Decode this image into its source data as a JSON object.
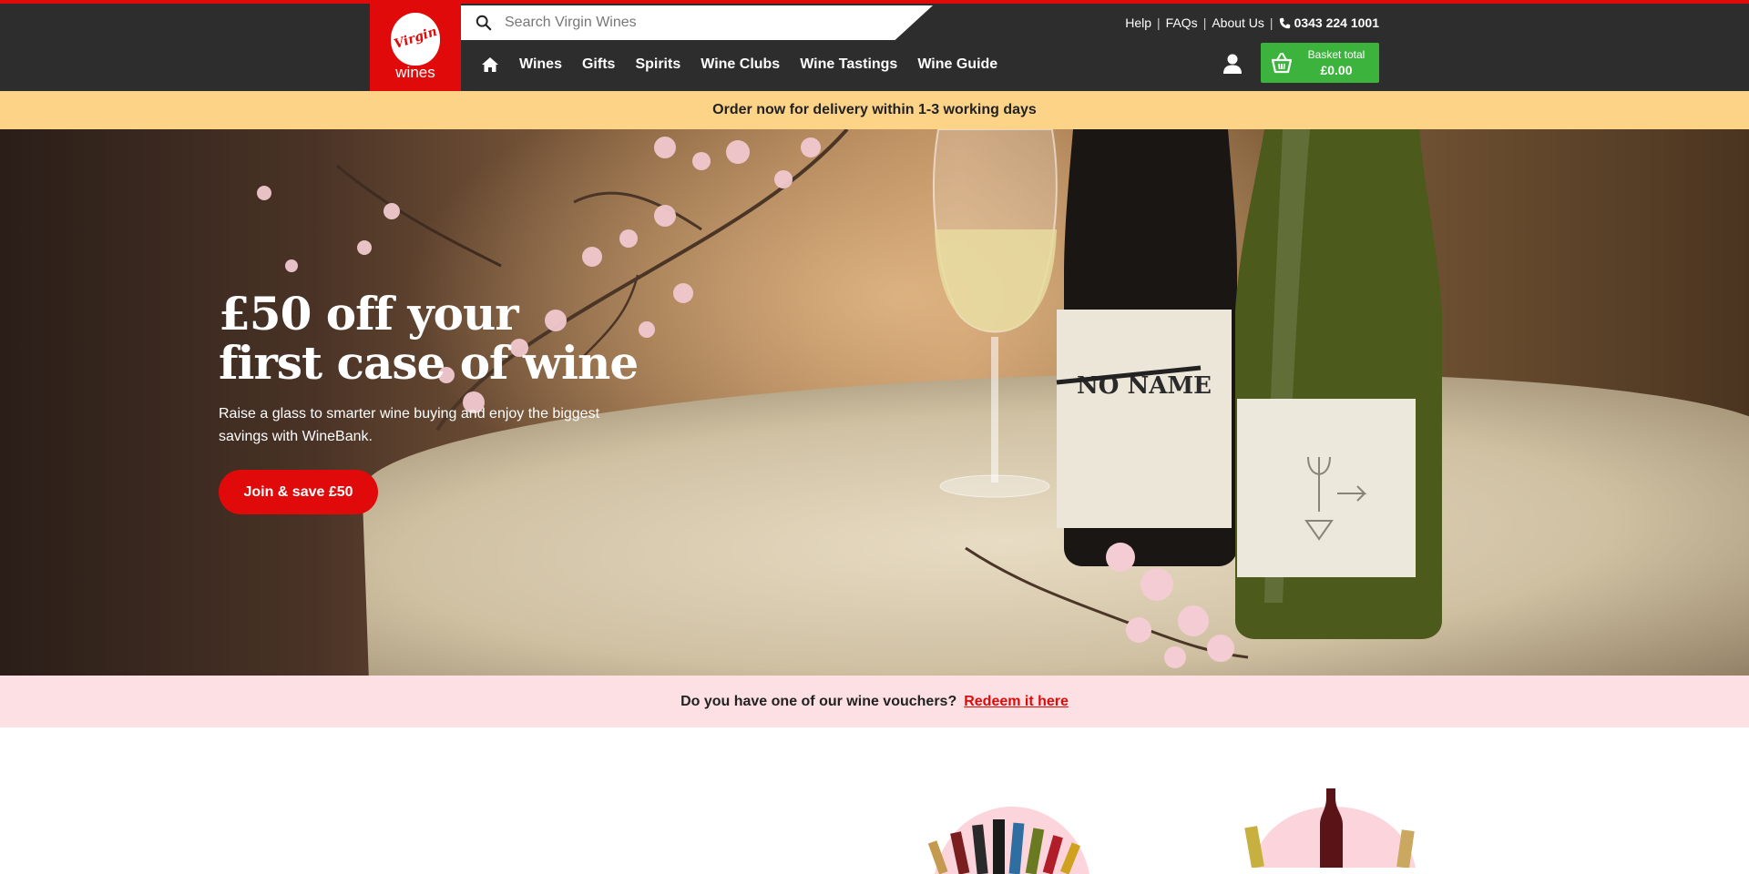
{
  "brand": {
    "logo_script": "Virgin",
    "logo_word": "wines",
    "red": "#e10a0a",
    "green": "#3cb33c",
    "dark": "#2d2d2d"
  },
  "search": {
    "placeholder": "Search Virgin Wines"
  },
  "utility": {
    "links": [
      "Help",
      "FAQs",
      "About Us"
    ],
    "phone": "0343 224 1001"
  },
  "nav": {
    "home_icon": "home-icon",
    "items": [
      "Wines",
      "Gifts",
      "Spirits",
      "Wine Clubs",
      "Wine Tastings",
      "Wine Guide"
    ]
  },
  "basket": {
    "label": "Basket total",
    "value": "£0.00"
  },
  "banner": {
    "text": "Order now for delivery within 1-3 working days",
    "color": "#fdd388"
  },
  "hero": {
    "headline_line1": "£50 off your",
    "headline_line2": "first case of wine",
    "subtext": "Raise a glass to smarter wine buying and enjoy the biggest savings with WineBank.",
    "cta": "Join & save £50",
    "bottle_label": "NO NAME"
  },
  "voucher": {
    "text": "Do you have one of our wine vouchers?",
    "link": "Redeem it here",
    "color": "#fde0e3"
  }
}
